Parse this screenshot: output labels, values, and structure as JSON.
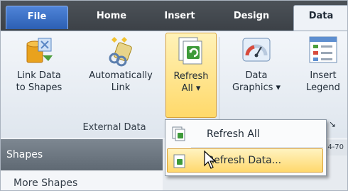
{
  "tabs": [
    {
      "label": "File"
    },
    {
      "label": "Home"
    },
    {
      "label": "Insert"
    },
    {
      "label": "Design"
    },
    {
      "label": "Data"
    }
  ],
  "ribbon": {
    "link_data": {
      "line1": "Link Data",
      "line2": "to Shapes"
    },
    "auto_link": {
      "line1": "Automatically",
      "line2": "Link"
    },
    "refresh_all": {
      "line1": "Refresh",
      "line2": "All ▾"
    },
    "data_graphics": {
      "line1": "Data",
      "line2": "Graphics ▾"
    },
    "insert_legend": {
      "line1": "Insert",
      "line2": "Legend"
    },
    "group_label": "External Data",
    "launcher": "↘"
  },
  "dropdown": {
    "items": [
      {
        "label": "Refresh All"
      },
      {
        "label": "Refresh Data..."
      }
    ]
  },
  "shapes_pane": {
    "title": "Shapes",
    "item": "More Shapes",
    "ruler_text": "|4-70"
  }
}
